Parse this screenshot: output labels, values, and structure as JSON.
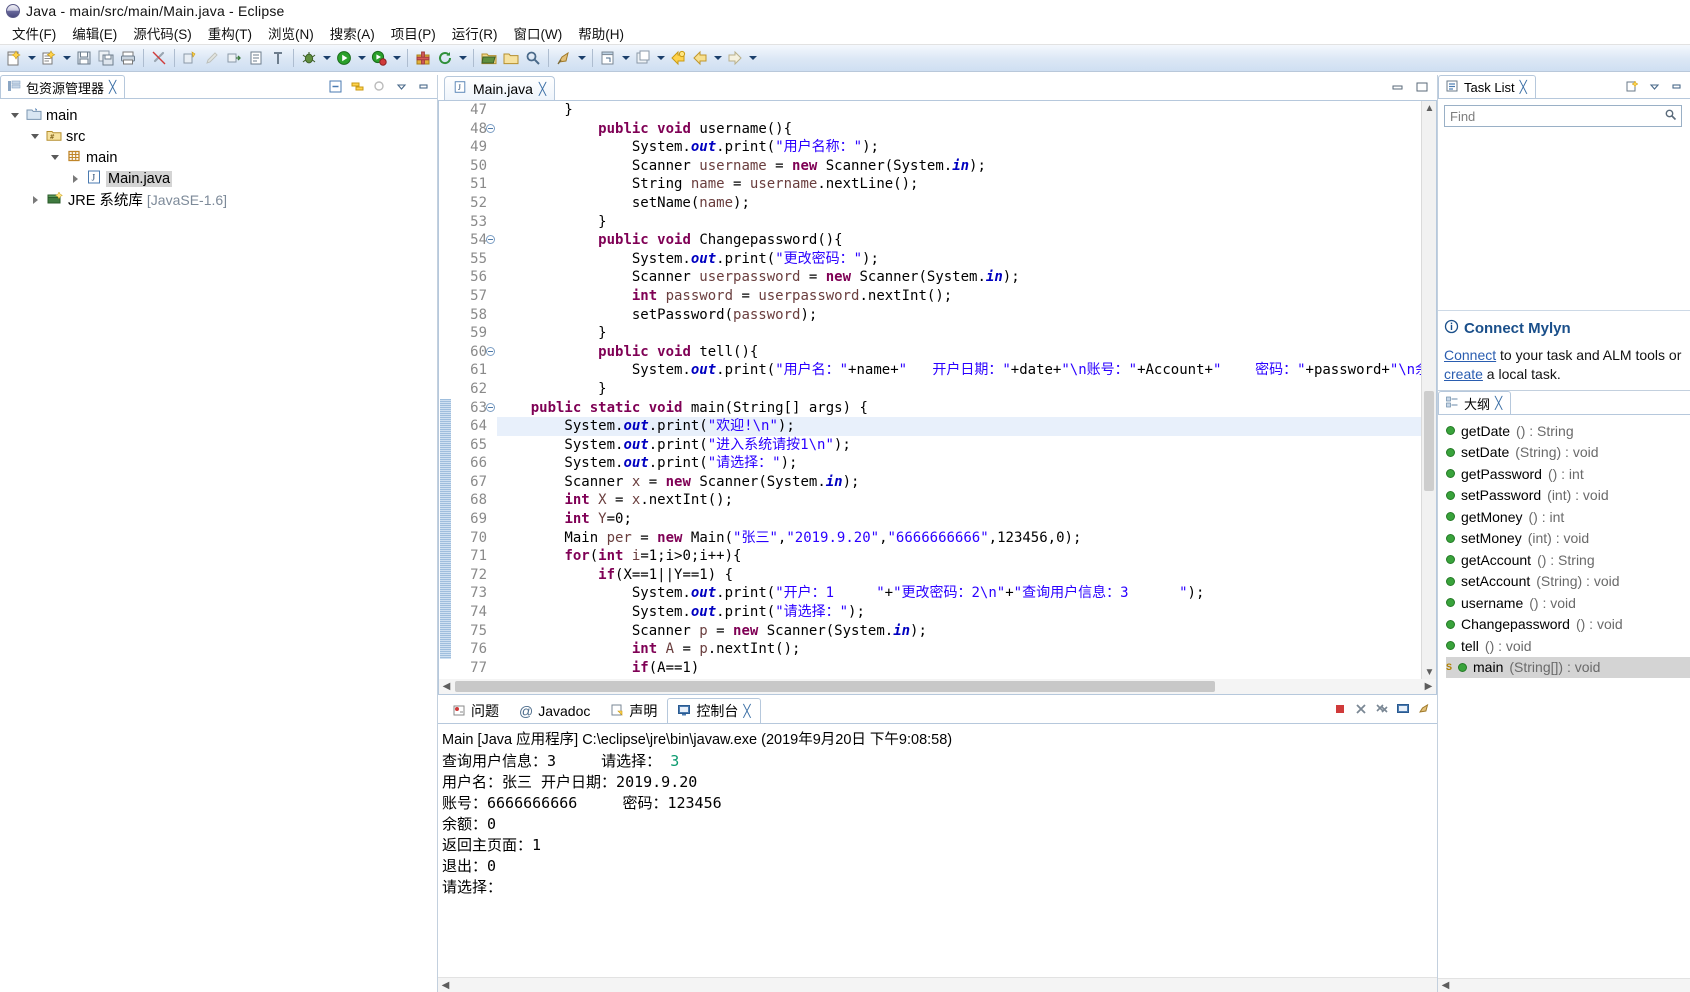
{
  "window": {
    "title": "Java - main/src/main/Main.java - Eclipse",
    "app_icon": "eclipse-icon"
  },
  "menubar": {
    "items": [
      {
        "label": "文件(F)"
      },
      {
        "label": "编辑(E)"
      },
      {
        "label": "源代码(S)"
      },
      {
        "label": "重构(T)"
      },
      {
        "label": "浏览(N)"
      },
      {
        "label": "搜索(A)"
      },
      {
        "label": "项目(P)"
      },
      {
        "label": "运行(R)"
      },
      {
        "label": "窗口(W)"
      },
      {
        "label": "帮助(H)"
      }
    ]
  },
  "toolbar": {
    "groups": [
      [
        "new-wizard",
        "dropdown",
        "new-java-package",
        "dropdown"
      ],
      [
        "save",
        "save-all",
        "print"
      ],
      [
        "link-broken"
      ],
      [
        "build-all",
        "pencil",
        "export-jar",
        "open-type",
        "show-whitespace"
      ],
      [
        "debug",
        "dropdown",
        "run",
        "dropdown",
        "run-coverage",
        "dropdown"
      ],
      [
        "new-java-project",
        "refresh",
        "dropdown"
      ],
      [
        "open-resource",
        "open-folder",
        "search"
      ],
      [
        "pin-editor",
        "dropdown"
      ],
      [
        "new-window",
        "dropdown"
      ],
      [
        "back-yellow",
        "back",
        "dropdown",
        "forward",
        "dropdown"
      ]
    ]
  },
  "package_explorer": {
    "tab_label": "包资源管理器",
    "tab_icon": "package-explorer-icon",
    "close_icon": "close-icon",
    "tools": [
      "collapse-all-icon",
      "link-with-editor-icon",
      "focus-icon",
      "view-menu-icon",
      "minimize-icon"
    ],
    "tree": [
      {
        "depth": 0,
        "twisty": "down",
        "icon": "java-project-icon",
        "label": "main",
        "sub": ""
      },
      {
        "depth": 1,
        "twisty": "down",
        "icon": "source-folder-icon",
        "label": "src",
        "sub": ""
      },
      {
        "depth": 2,
        "twisty": "down",
        "icon": "package-icon",
        "label": "main",
        "sub": ""
      },
      {
        "depth": 3,
        "twisty": "right",
        "icon": "java-file-icon",
        "label": "Main.java",
        "sub": "",
        "selected": true
      },
      {
        "depth": 1,
        "twisty": "right",
        "icon": "jre-library-icon",
        "label": "JRE 系统库",
        "sub": "[JavaSE-1.6]"
      }
    ]
  },
  "editor": {
    "tab": {
      "label": "Main.java",
      "icon": "java-file-icon",
      "close_icon": "close-icon"
    },
    "window_buttons": [
      "minimize-icon",
      "maximize-icon"
    ],
    "highlighted_line": 64,
    "first_line": 47,
    "lines": [
      {
        "n": 47,
        "fold": false,
        "tokens": [
          [
            "pln",
            "        }"
          ]
        ]
      },
      {
        "n": 48,
        "fold": true,
        "tokens": [
          [
            "pln",
            "            "
          ],
          [
            "kw",
            "public void "
          ],
          [
            "pln",
            "username(){"
          ]
        ]
      },
      {
        "n": 49,
        "fold": false,
        "tokens": [
          [
            "pln",
            "                System."
          ],
          [
            "fld",
            "out"
          ],
          [
            "pln",
            ".print("
          ],
          [
            "str",
            "\"用户名称："
          ],
          [
            "str",
            "\""
          ],
          [
            "pln",
            ");"
          ]
        ]
      },
      {
        "n": 50,
        "fold": false,
        "tokens": [
          [
            "pln",
            "                Scanner "
          ],
          [
            "loc",
            "username"
          ],
          [
            "pln",
            " = "
          ],
          [
            "kw",
            "new "
          ],
          [
            "pln",
            "Scanner(System."
          ],
          [
            "fld",
            "in"
          ],
          [
            "pln",
            ");"
          ]
        ]
      },
      {
        "n": 51,
        "fold": false,
        "tokens": [
          [
            "pln",
            "                String "
          ],
          [
            "loc",
            "name"
          ],
          [
            "pln",
            " = "
          ],
          [
            "loc",
            "username"
          ],
          [
            "pln",
            ".nextLine();"
          ]
        ]
      },
      {
        "n": 52,
        "fold": false,
        "tokens": [
          [
            "pln",
            "                setName("
          ],
          [
            "loc",
            "name"
          ],
          [
            "pln",
            ");"
          ]
        ]
      },
      {
        "n": 53,
        "fold": false,
        "tokens": [
          [
            "pln",
            "            }"
          ]
        ]
      },
      {
        "n": 54,
        "fold": true,
        "tokens": [
          [
            "pln",
            "            "
          ],
          [
            "kw",
            "public void "
          ],
          [
            "pln",
            "Changepassword(){"
          ]
        ]
      },
      {
        "n": 55,
        "fold": false,
        "tokens": [
          [
            "pln",
            "                System."
          ],
          [
            "fld",
            "out"
          ],
          [
            "pln",
            ".print("
          ],
          [
            "str",
            "\"更改密码：\""
          ],
          [
            "pln",
            ");"
          ]
        ]
      },
      {
        "n": 56,
        "fold": false,
        "tokens": [
          [
            "pln",
            "                Scanner "
          ],
          [
            "loc",
            "userpassword"
          ],
          [
            "pln",
            " = "
          ],
          [
            "kw",
            "new "
          ],
          [
            "pln",
            "Scanner(System."
          ],
          [
            "fld",
            "in"
          ],
          [
            "pln",
            ");"
          ]
        ]
      },
      {
        "n": 57,
        "fold": false,
        "tokens": [
          [
            "pln",
            "                "
          ],
          [
            "kw",
            "int "
          ],
          [
            "loc",
            "password"
          ],
          [
            "pln",
            " = "
          ],
          [
            "loc",
            "userpassword"
          ],
          [
            "pln",
            ".nextInt();"
          ]
        ]
      },
      {
        "n": 58,
        "fold": false,
        "tokens": [
          [
            "pln",
            "                setPassword("
          ],
          [
            "loc",
            "password"
          ],
          [
            "pln",
            ");"
          ]
        ]
      },
      {
        "n": 59,
        "fold": false,
        "tokens": [
          [
            "pln",
            "            }"
          ]
        ]
      },
      {
        "n": 60,
        "fold": true,
        "tokens": [
          [
            "pln",
            "            "
          ],
          [
            "kw",
            "public void "
          ],
          [
            "pln",
            "tell(){"
          ]
        ]
      },
      {
        "n": 61,
        "fold": false,
        "tokens": [
          [
            "pln",
            "                System."
          ],
          [
            "fld",
            "out"
          ],
          [
            "pln",
            ".print("
          ],
          [
            "str",
            "\"用户名：\""
          ],
          [
            "pln",
            "+name+"
          ],
          [
            "str",
            "\"   开户日期：\""
          ],
          [
            "pln",
            "+date+"
          ],
          [
            "str",
            "\"\\n账号：\""
          ],
          [
            "pln",
            "+Account+"
          ],
          [
            "str",
            "\"    密码：\""
          ],
          [
            "pln",
            "+password+"
          ],
          [
            "str",
            "\"\\n余"
          ]
        ]
      },
      {
        "n": 62,
        "fold": false,
        "tokens": [
          [
            "pln",
            "            }"
          ]
        ]
      },
      {
        "n": 63,
        "fold": true,
        "tokens": [
          [
            "kw",
            "    public static void "
          ],
          [
            "pln",
            "main(String[] args) {"
          ]
        ]
      },
      {
        "n": 64,
        "fold": false,
        "tokens": [
          [
            "pln",
            "        System."
          ],
          [
            "fld",
            "out"
          ],
          [
            "pln",
            ".print("
          ],
          [
            "str",
            "\"欢迎!\\n\""
          ],
          [
            "pln",
            ");"
          ]
        ]
      },
      {
        "n": 65,
        "fold": false,
        "tokens": [
          [
            "pln",
            "        System."
          ],
          [
            "fld",
            "out"
          ],
          [
            "pln",
            ".print("
          ],
          [
            "str",
            "\"进入系统请按1\\n\""
          ],
          [
            "pln",
            ");"
          ]
        ]
      },
      {
        "n": 66,
        "fold": false,
        "tokens": [
          [
            "pln",
            "        System."
          ],
          [
            "fld",
            "out"
          ],
          [
            "pln",
            ".print("
          ],
          [
            "str",
            "\"请选择：\""
          ],
          [
            "pln",
            ");"
          ]
        ]
      },
      {
        "n": 67,
        "fold": false,
        "tokens": [
          [
            "pln",
            "        Scanner "
          ],
          [
            "loc",
            "x"
          ],
          [
            "pln",
            " = "
          ],
          [
            "kw",
            "new "
          ],
          [
            "pln",
            "Scanner(System."
          ],
          [
            "fld",
            "in"
          ],
          [
            "pln",
            ");"
          ]
        ]
      },
      {
        "n": 68,
        "fold": false,
        "tokens": [
          [
            "pln",
            "        "
          ],
          [
            "kw",
            "int "
          ],
          [
            "loc",
            "X"
          ],
          [
            "pln",
            " = "
          ],
          [
            "loc",
            "x"
          ],
          [
            "pln",
            ".nextInt();"
          ]
        ]
      },
      {
        "n": 69,
        "fold": false,
        "tokens": [
          [
            "pln",
            "        "
          ],
          [
            "kw",
            "int "
          ],
          [
            "loc",
            "Y"
          ],
          [
            "pln",
            "=0;"
          ]
        ]
      },
      {
        "n": 70,
        "fold": false,
        "tokens": [
          [
            "pln",
            "        Main "
          ],
          [
            "loc",
            "per"
          ],
          [
            "pln",
            " = "
          ],
          [
            "kw",
            "new "
          ],
          [
            "pln",
            "Main("
          ],
          [
            "str",
            "\"张三\""
          ],
          [
            "pln",
            ","
          ],
          [
            "str",
            "\"2019.9.20\""
          ],
          [
            "pln",
            ","
          ],
          [
            "str",
            "\"6666666666\""
          ],
          [
            "pln",
            ",123456,0);"
          ]
        ]
      },
      {
        "n": 71,
        "fold": false,
        "tokens": [
          [
            "pln",
            "        "
          ],
          [
            "kw",
            "for"
          ],
          [
            "pln",
            "("
          ],
          [
            "kw",
            "int "
          ],
          [
            "loc",
            "i"
          ],
          [
            "pln",
            "=1;i>0;i++){"
          ]
        ]
      },
      {
        "n": 72,
        "fold": false,
        "tokens": [
          [
            "pln",
            "            "
          ],
          [
            "kw",
            "if"
          ],
          [
            "pln",
            "(X==1||Y==1) {"
          ]
        ]
      },
      {
        "n": 73,
        "fold": false,
        "tokens": [
          [
            "pln",
            "                System."
          ],
          [
            "fld",
            "out"
          ],
          [
            "pln",
            ".print("
          ],
          [
            "str",
            "\"开户：1     \""
          ],
          [
            "pln",
            "+"
          ],
          [
            "str",
            "\"更改密码：2\\n\""
          ],
          [
            "pln",
            "+"
          ],
          [
            "str",
            "\"查询用户信息：3      \""
          ],
          [
            "pln",
            ");"
          ]
        ]
      },
      {
        "n": 74,
        "fold": false,
        "tokens": [
          [
            "pln",
            "                System."
          ],
          [
            "fld",
            "out"
          ],
          [
            "pln",
            ".print("
          ],
          [
            "str",
            "\"请选择：\""
          ],
          [
            "pln",
            ");"
          ]
        ]
      },
      {
        "n": 75,
        "fold": false,
        "tokens": [
          [
            "pln",
            "                Scanner "
          ],
          [
            "loc",
            "p"
          ],
          [
            "pln",
            " = "
          ],
          [
            "kw",
            "new "
          ],
          [
            "pln",
            "Scanner(System."
          ],
          [
            "fld",
            "in"
          ],
          [
            "pln",
            ");"
          ]
        ]
      },
      {
        "n": 76,
        "fold": false,
        "tokens": [
          [
            "pln",
            "                "
          ],
          [
            "kw",
            "int "
          ],
          [
            "loc",
            "A"
          ],
          [
            "pln",
            " = "
          ],
          [
            "loc",
            "p"
          ],
          [
            "pln",
            ".nextInt();"
          ]
        ]
      },
      {
        "n": 77,
        "fold": false,
        "tokens": [
          [
            "pln",
            "                "
          ],
          [
            "kw",
            "if"
          ],
          [
            "pln",
            "(A==1)"
          ]
        ]
      }
    ]
  },
  "bottom_panel": {
    "tabs": [
      {
        "label": "问题",
        "icon": "problems-icon",
        "active": false
      },
      {
        "label": "Javadoc",
        "icon": "javadoc-icon",
        "active": false
      },
      {
        "label": "声明",
        "icon": "declaration-icon",
        "active": false
      },
      {
        "label": "控制台",
        "icon": "console-icon",
        "active": true,
        "close_icon": "close-icon"
      }
    ],
    "tools": [
      "terminate-icon",
      "remove-launch-icon",
      "remove-all-icon",
      "display-selected-icon",
      "pin-console-icon"
    ],
    "console": {
      "header": "Main [Java 应用程序] C:\\eclipse\\jre\\bin\\javaw.exe  (2019年9月20日 下午9:08:58)",
      "lines": [
        {
          "text": "查询用户信息：3     请选择：",
          "input": "3"
        },
        {
          "text": "用户名：张三 开户日期：2019.9.20",
          "input": ""
        },
        {
          "text": "账号：6666666666     密码：123456",
          "input": ""
        },
        {
          "text": "余额：0",
          "input": ""
        },
        {
          "text": "返回主页面：1",
          "input": ""
        },
        {
          "text": "退出：0",
          "input": ""
        },
        {
          "text": "请选择：",
          "input": ""
        }
      ]
    }
  },
  "task_list": {
    "tab_label": "Task List",
    "tab_icon": "task-list-icon",
    "close_icon": "close-icon",
    "tools": [
      "new-task-icon",
      "view-menu-icon",
      "minimize-icon",
      "maximize-icon"
    ],
    "find_placeholder": "Find",
    "find_value": "",
    "search_icon": "search-icon",
    "mylyn": {
      "icon": "info-icon",
      "title": "Connect Mylyn",
      "line1_link": "Connect",
      "line1_rest": " to your task and ALM tools or",
      "line2_link": "create",
      "line2_rest": " a local task."
    }
  },
  "outline": {
    "tab_label": "大纲",
    "tab_icon": "outline-icon",
    "close_icon": "close-icon",
    "items": [
      {
        "label": "getDate",
        "type": "() : String",
        "icon": "public-method-icon"
      },
      {
        "label": "setDate",
        "type": "(String) : void",
        "icon": "public-method-icon"
      },
      {
        "label": "getPassword",
        "type": "() : int",
        "icon": "public-method-icon"
      },
      {
        "label": "setPassword",
        "type": "(int) : void",
        "icon": "public-method-icon"
      },
      {
        "label": "getMoney",
        "type": "() : int",
        "icon": "public-method-icon"
      },
      {
        "label": "setMoney",
        "type": "(int) : void",
        "icon": "public-method-icon"
      },
      {
        "label": "getAccount",
        "type": "() : String",
        "icon": "public-method-icon"
      },
      {
        "label": "setAccount",
        "type": "(String) : void",
        "icon": "public-method-icon"
      },
      {
        "label": "username",
        "type": "() : void",
        "icon": "public-method-icon"
      },
      {
        "label": "Changepassword",
        "type": "() : void",
        "icon": "public-method-icon"
      },
      {
        "label": "tell",
        "type": "() : void",
        "icon": "public-method-icon"
      },
      {
        "label": "main",
        "type": "(String[]) : void",
        "icon": "static-method-icon",
        "selected": true
      }
    ]
  },
  "colors": {
    "keyword": "#7f0055",
    "string": "#2a00ff",
    "field": "#0000c0",
    "local": "#6a3e3e",
    "line_number": "#8a8a8a",
    "highlight_line": "#e8f0fb",
    "toolbar_bg": "#dbe7f5",
    "link": "#2a5db0",
    "console_input": "#0a9a6e"
  }
}
